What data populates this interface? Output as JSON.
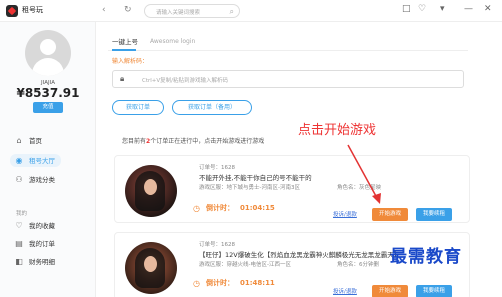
{
  "app": {
    "title": "租号玩"
  },
  "header": {
    "search_placeholder": "请输入关键词搜索",
    "back": "‹",
    "refresh": "↻",
    "controls": [
      "□",
      "♡",
      "▾",
      "—",
      "✕"
    ]
  },
  "user": {
    "name": "JIAJIA",
    "balance": "¥8537.91",
    "recharge_label": "充值"
  },
  "sidebar": {
    "items": [
      {
        "label": "首页",
        "icon": "⌂"
      },
      {
        "label": "租号大厅",
        "icon": "◉"
      },
      {
        "label": "游戏分类",
        "icon": "⚇"
      }
    ],
    "section_mine": "我的",
    "mine_items": [
      {
        "label": "我的收藏",
        "icon": "♡"
      },
      {
        "label": "我的订单",
        "icon": "▤"
      },
      {
        "label": "财务明细",
        "icon": "◧"
      }
    ]
  },
  "main": {
    "tab_login": "一键上号",
    "tab_login_en": "Awesome login",
    "input_label": "输入解析码：",
    "input_placeholder": "Ctrl+V复制/粘贴到游戏输入解析码",
    "btn_get_order": "获取订单",
    "btn_get_order_backup": "获取订单（备用）",
    "notice_prefix": "您目前有",
    "notice_count": "2",
    "notice_suffix": "个订单正在进行中，点击开始游戏进行游戏"
  },
  "annotation": "点击开始游戏",
  "orders": [
    {
      "order_id": "订单号：1628",
      "title": "不能开外挂,不能干你自己的号不能干的",
      "info": "游戏区服：地下城与勇士-河南区-河南3区",
      "role": "角色名：灰色星映",
      "timer_label": "倒计时：",
      "timer_value": "01:04:15",
      "complaint": "投诉/退款",
      "start": "开始游戏",
      "renew": "我要续租"
    },
    {
      "order_id": "订单号：1628",
      "title": "【旺仔】12V爆破生化【烈焰血龙黑龙霸神火麒麟极光无龙黑龙霸天】",
      "info": "游戏区服：穿越火线-电信区-江西一区",
      "role": "角色名：6分钟删",
      "timer_label": "倒计时：",
      "timer_value": "01:48:11",
      "complaint": "投诉/退款",
      "start": "开始游戏",
      "renew": "我要续租"
    }
  ],
  "watermark": "最需教育",
  "colors": {
    "accent": "#3aa0e8",
    "orange": "#f08a3a",
    "red_annotation": "#e33333",
    "watermark_blue": "#1a49c9"
  }
}
